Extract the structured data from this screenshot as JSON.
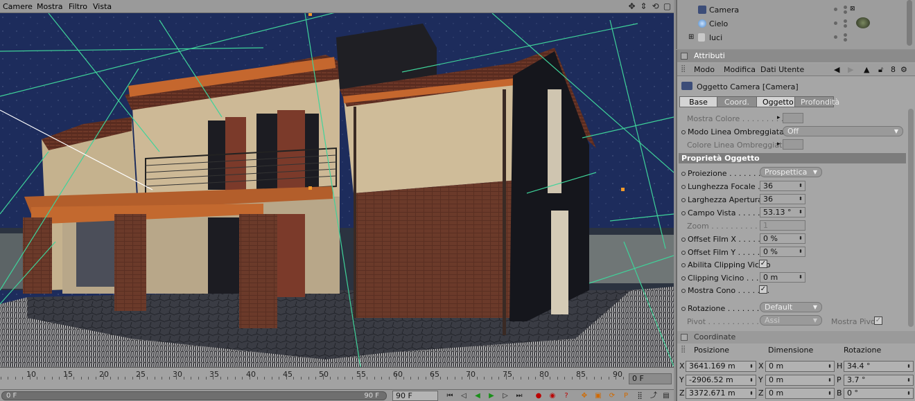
{
  "viewport_menu": {
    "items": [
      "Camere",
      "Mostra",
      "Filtro",
      "Vista"
    ]
  },
  "timeline": {
    "ticks": [
      "10",
      "15",
      "20",
      "25",
      "30",
      "35",
      "40",
      "45",
      "50",
      "55",
      "60",
      "65",
      "70",
      "75",
      "80",
      "85",
      "90"
    ],
    "current_frame": "0 F",
    "range_start": "0 F",
    "range_end": "90 F",
    "end_frame": "90 F"
  },
  "object_manager": {
    "items": [
      {
        "name": "Camera",
        "icon": "camera-icon"
      },
      {
        "name": "Cielo",
        "icon": "sky-sphere-icon"
      },
      {
        "name": "luci",
        "icon": "light-group-icon"
      }
    ]
  },
  "attributes": {
    "title": "Attributi",
    "menu": [
      "Modo",
      "Modifica",
      "Dati Utente"
    ],
    "object_title": "Oggetto Camera [Camera]",
    "tabs": [
      {
        "label": "Base",
        "active": true
      },
      {
        "label": "Coord.",
        "active": false
      },
      {
        "label": "Oggetto",
        "active": true
      },
      {
        "label": "Profondità",
        "active": false
      }
    ],
    "top_props": {
      "mostra_colore": "Mostra Colore . . . . . . . . .",
      "modo_linea": "Modo Linea Ombreggiata",
      "modo_linea_value": "Off",
      "colore_linea": "Colore Linea Ombreggiata"
    },
    "section_header": "Proprietà Oggetto",
    "props": {
      "proiezione": "Proiezione . . . . . . . . . . .",
      "proiezione_value": "Prospettica",
      "lunghezza_focale": "Lunghezza Focale . . .",
      "lunghezza_focale_value": "36",
      "larghezza_apertura": "Larghezza Apertura",
      "larghezza_apertura_value": "36",
      "campo_vista": "Campo Vista . . . . . . .",
      "campo_vista_value": "53.13 °",
      "zoom": "Zoom . . . . . . . . . . . . . .",
      "zoom_value": "1",
      "offset_x": "Offset Film X . . . . . . .",
      "offset_x_value": "0 %",
      "offset_y": "Offset Film Y . . . . . . .",
      "offset_y_value": "0 %",
      "abilita_clipping": "Abilita Clipping Vicino",
      "clipping_vicino": "Clipping Vicino . . . . .",
      "clipping_vicino_value": "0 m",
      "mostra_cono": "Mostra Cono . . . . . . .",
      "rotazione": "Rotazione . . . . . . . . . .",
      "rotazione_value": "Default",
      "pivot": "Pivot . . . . . . . . . . . . . . .",
      "pivot_value": "Assi",
      "mostra_pivot": "Mostra Pivot"
    }
  },
  "coordinates": {
    "title": "Coordinate",
    "headers": [
      "Posizione",
      "Dimensione",
      "Rotazione"
    ],
    "rows": [
      {
        "axis": "X",
        "pos": "3641.169 m",
        "dim_axis": "X",
        "dim": "0 m",
        "rot_axis": "H",
        "rot": "34.4 °"
      },
      {
        "axis": "Y",
        "pos": "-2906.52 m",
        "dim_axis": "Y",
        "dim": "0 m",
        "rot_axis": "P",
        "rot": "3.7 °"
      },
      {
        "axis": "Z",
        "pos": "3372.671 m",
        "dim_axis": "Z",
        "dim": "0 m",
        "rot_axis": "B",
        "rot": "0 °"
      }
    ]
  }
}
